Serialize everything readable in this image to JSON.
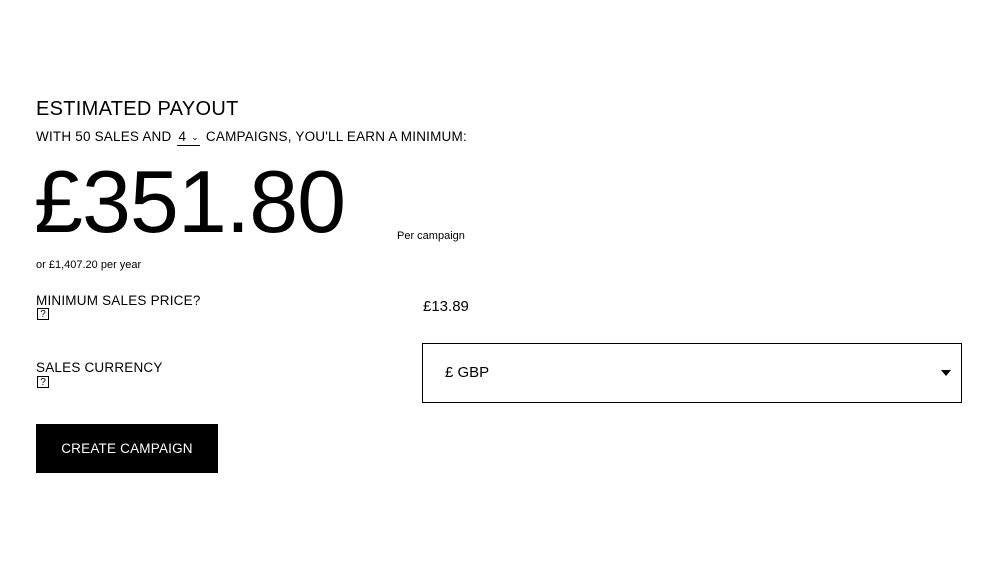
{
  "payout": {
    "heading": "ESTIMATED PAYOUT",
    "subline_prefix": "WITH 50 SALES AND",
    "campaigns_selected": "4",
    "subline_suffix": "CAMPAIGNS, YOU'LL EARN A MINIMUM:",
    "amount": "£351.80",
    "per_campaign_label": "Per campaign",
    "per_year_text": "or £1,407.20 per year"
  },
  "fields": {
    "min_sales_price_label": "MINIMUM SALES PRICE?",
    "min_sales_price_value": "£13.89",
    "sales_currency_label": "SALES CURRENCY",
    "sales_currency_value": "£ GBP",
    "help_glyph": "?"
  },
  "actions": {
    "create_campaign_label": "CREATE CAMPAIGN"
  },
  "icons": {
    "campaign_dropdown": "chevron-down-icon",
    "currency_dropdown": "caret-down-icon",
    "help": "help-icon"
  }
}
